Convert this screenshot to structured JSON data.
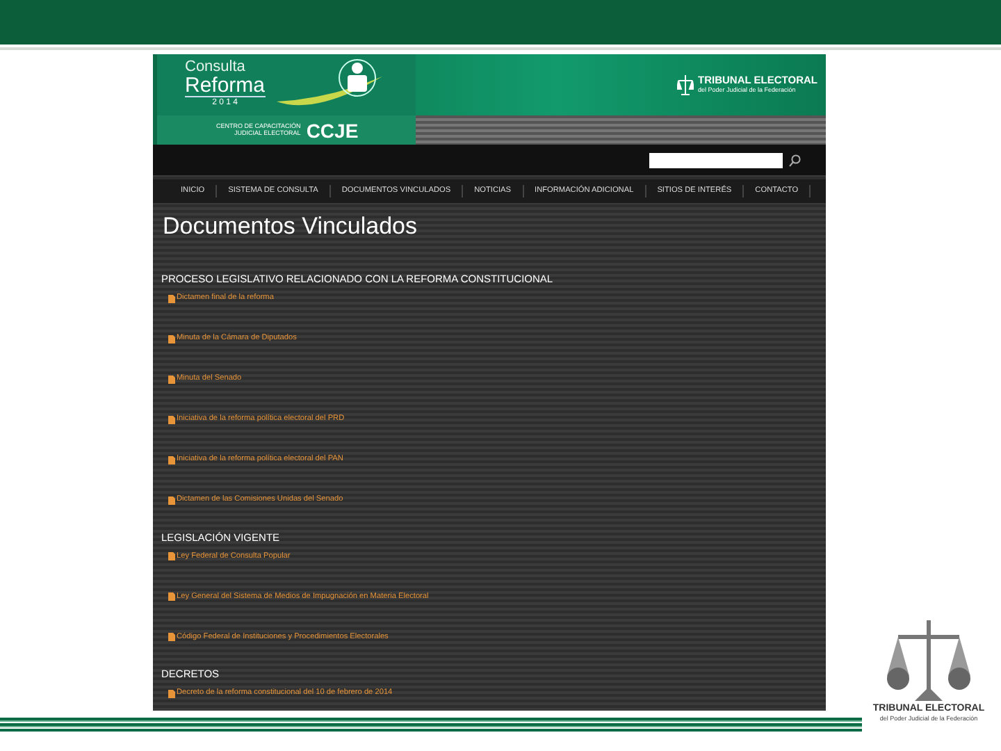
{
  "site_header": {
    "logo_line_1": "Consulta",
    "logo_line_2": "Reforma",
    "logo_year": "2 0 1 4",
    "ccje_caption": "CENTRO DE CAPACITACIÓN JUDICIAL ELECTORAL",
    "ccje_acronym": "CCJE",
    "tribunal_name": "TRIBUNAL ELECTORAL",
    "tribunal_subtitle": "del Poder Judicial de la Federación"
  },
  "nav": [
    {
      "label": "INICIO",
      "selected": false
    },
    {
      "label": "SISTEMA DE CONSULTA",
      "selected": false
    },
    {
      "label": "DOCUMENTOS VINCULADOS",
      "selected": false
    },
    {
      "label": "NOTICIAS",
      "selected": false
    },
    {
      "label": "INFORMACIÓN ADICIONAL",
      "selected": false
    },
    {
      "label": "SITIOS DE INTERÉS",
      "selected": false
    },
    {
      "label": "CONTACTO",
      "selected": false
    }
  ],
  "page_title": "Documentos Vinculados",
  "sections": [
    {
      "heading": "PROCESO LEGISLATIVO RELACIONADO CON LA REFORMA CONSTITUCIONAL",
      "links": [
        "Dictamen final de la reforma",
        "Minuta de la Cámara de Diputados",
        "Minuta del Senado",
        "Iniciativa de la reforma política electoral del PRD",
        "Iniciativa de la reforma política electoral del PAN",
        "Dictamen de las Comisiones Unidas del Senado"
      ]
    },
    {
      "heading": "LEGISLACIÓN VIGENTE",
      "links": [
        "Ley Federal de Consulta Popular",
        "Ley General del Sistema de Medios de Impugnación en Materia Electoral",
        "Código Federal de Instituciones y Procedimientos Electorales"
      ]
    },
    {
      "heading": "DECRETOS",
      "links": [
        "Decreto de la reforma constitucional del 10 de febrero de 2014"
      ]
    }
  ],
  "slide_logo": {
    "name": "TRIBUNAL ELECTORAL",
    "subtitle": "del Poder Judicial de la Federación"
  }
}
